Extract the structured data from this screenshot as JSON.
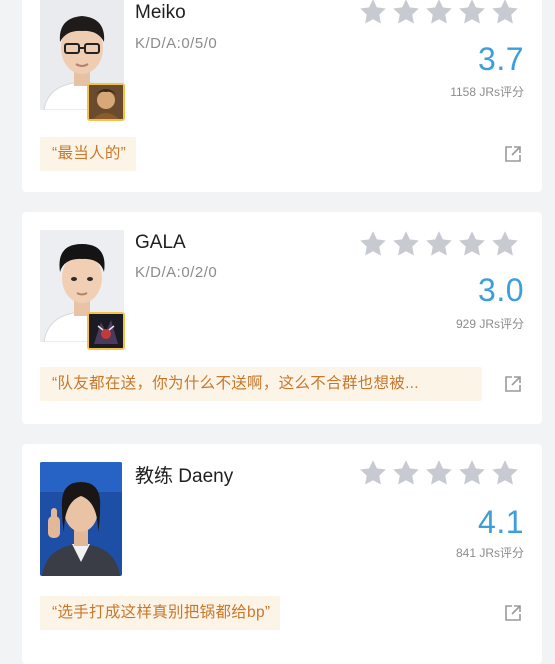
{
  "colors": {
    "page_background": "#f2f3f5",
    "card_background": "#ffffff",
    "rating_blue": "#3b9fdc",
    "star_gray": "#c7cad0",
    "quote_background": "#fdf4e8",
    "quote_text": "#c8772b",
    "hero_border": "#f3c24a"
  },
  "players": [
    {
      "name": "Meiko",
      "kda": "K/D/A:0/5/0",
      "rating": "3.7",
      "rating_count": "1158 JRs评分",
      "quote": "“最当人的”",
      "stars_filled": 0,
      "stars_total": 5,
      "has_hero_icon": true,
      "avatar_icon": "player-photo",
      "hero_icon": "hero-portrait-icon",
      "share_icon": "share-icon"
    },
    {
      "name": "GALA",
      "kda": "K/D/A:0/2/0",
      "rating": "3.0",
      "rating_count": "929 JRs评分",
      "quote": "“队友都在送，你为什么不送啊，这么不合群也想被...",
      "stars_filled": 0,
      "stars_total": 5,
      "has_hero_icon": true,
      "avatar_icon": "player-photo",
      "hero_icon": "hero-portrait-icon",
      "share_icon": "share-icon"
    },
    {
      "name": "教练 Daeny",
      "kda": "",
      "rating": "4.1",
      "rating_count": "841 JRs评分",
      "quote": "“选手打成这样真别把锅都给bp”",
      "stars_filled": 0,
      "stars_total": 5,
      "has_hero_icon": false,
      "avatar_icon": "coach-photo",
      "share_icon": "share-icon"
    }
  ]
}
